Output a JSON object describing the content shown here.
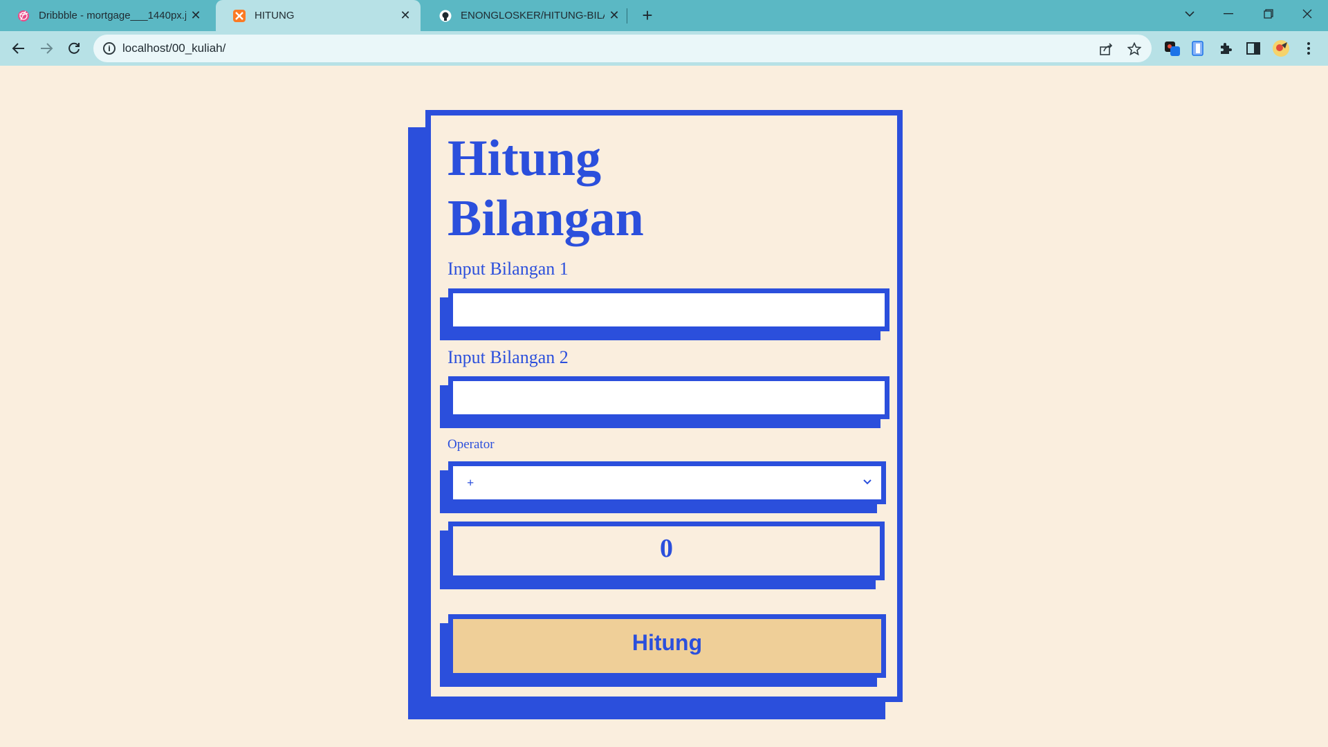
{
  "browser": {
    "tabs": [
      {
        "title": "Dribbble - mortgage___1440px.jpg",
        "icon": "dribbble-icon",
        "active": false
      },
      {
        "title": "HITUNG",
        "icon": "xampp-icon",
        "active": true
      },
      {
        "title": "ENONGLOSKER/HITUNG-BILANGAN",
        "icon": "github-icon",
        "active": false
      }
    ],
    "url": "localhost/00_kuliah/"
  },
  "page": {
    "heading_line1": "Hitung",
    "heading_line2": "Bilangan",
    "input1_label": "Input Bilangan 1",
    "input1_value": "",
    "input2_label": "Input Bilangan 2",
    "input2_value": "",
    "operator_label": "Operator",
    "operator_selected": "+",
    "result": "0",
    "submit_label": "Hitung"
  },
  "colors": {
    "accent": "#2b4fdc",
    "page_bg": "#faeede",
    "button_bg": "#efcf98",
    "tabstrip_bg": "#5bb8c4",
    "toolbar_bg": "#b7e1e6"
  }
}
